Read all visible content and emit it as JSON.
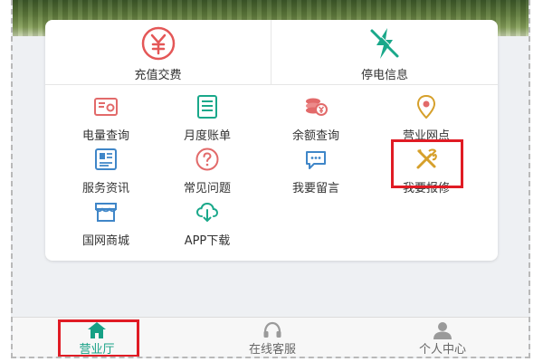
{
  "top_services": [
    {
      "label": "充值交费",
      "icon": "yuan-circle-icon"
    },
    {
      "label": "停电信息",
      "icon": "power-outage-icon"
    }
  ],
  "services": [
    {
      "label": "电量查询",
      "icon": "meter-card-icon"
    },
    {
      "label": "月度账单",
      "icon": "bill-list-icon"
    },
    {
      "label": "余额查询",
      "icon": "coins-icon"
    },
    {
      "label": "营业网点",
      "icon": "location-pin-icon"
    },
    {
      "label": "服务资讯",
      "icon": "newspaper-icon"
    },
    {
      "label": "常见问题",
      "icon": "question-icon"
    },
    {
      "label": "我要留言",
      "icon": "chat-bubble-icon"
    },
    {
      "label": "我要报修",
      "icon": "repair-tools-icon"
    },
    {
      "label": "国网商城",
      "icon": "store-icon"
    },
    {
      "label": "APP下载",
      "icon": "cloud-download-icon"
    }
  ],
  "tabs": [
    {
      "label": "营业厅",
      "icon": "home-icon",
      "active": true
    },
    {
      "label": "在线客服",
      "icon": "headset-icon",
      "active": false
    },
    {
      "label": "个人中心",
      "icon": "user-icon",
      "active": false
    }
  ],
  "colors": {
    "accent_red": "#e01b24",
    "accent_green": "#16a085",
    "icon_gold": "#d6a02b",
    "icon_blue": "#3f86c8",
    "icon_pink": "#e26a6a"
  }
}
